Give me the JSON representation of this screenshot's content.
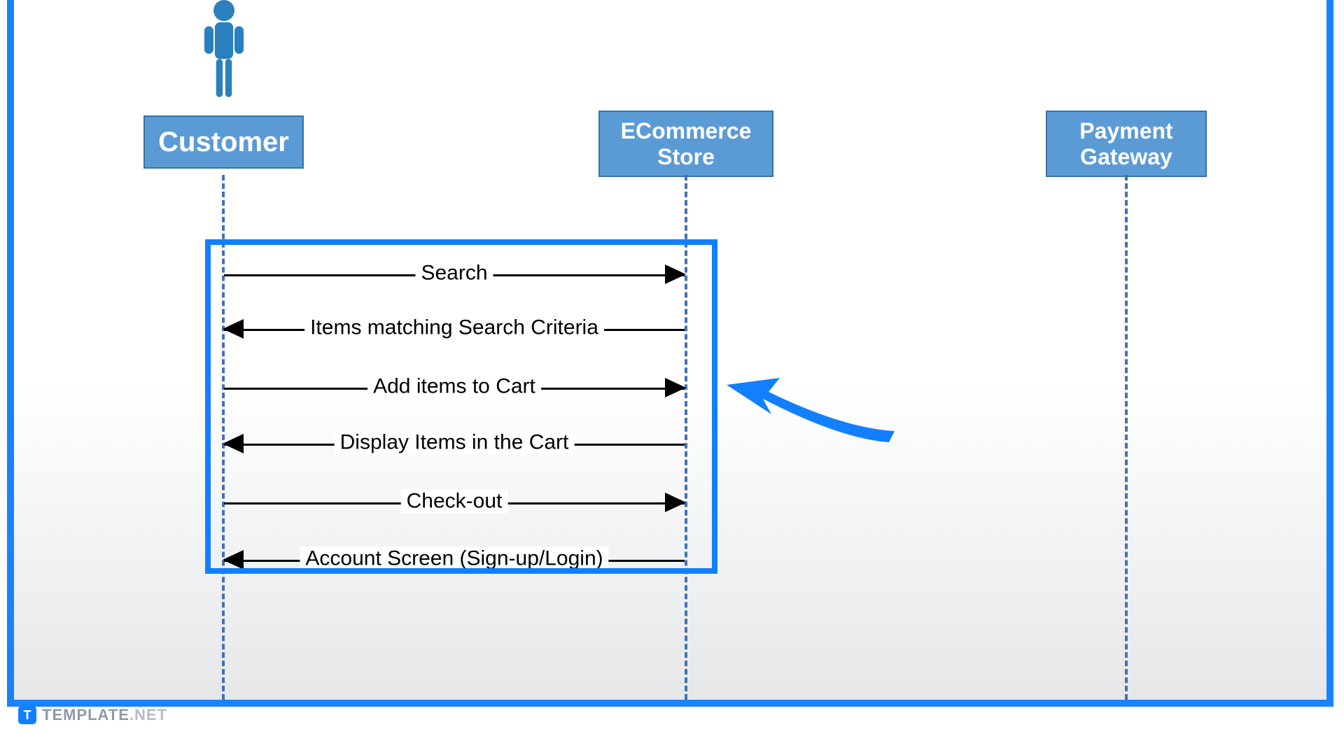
{
  "participants": {
    "customer": "Customer",
    "store_line1": "ECommerce",
    "store_line2": "Store",
    "gateway_line1": "Payment",
    "gateway_line2": "Gateway"
  },
  "messages": {
    "m1": "Search",
    "m2": "Items matching Search Criteria",
    "m3": "Add items to Cart",
    "m4": "Display Items in the Cart",
    "m5": "Check-out",
    "m6": "Account Screen (Sign-up/Login)"
  },
  "watermark": {
    "badge": "T",
    "brand": "TEMPLATE",
    "suffix": ".NET"
  },
  "colors": {
    "frame": "#1a82ff",
    "participant_fill": "#5b9bd5",
    "lifeline": "#4472b0"
  }
}
